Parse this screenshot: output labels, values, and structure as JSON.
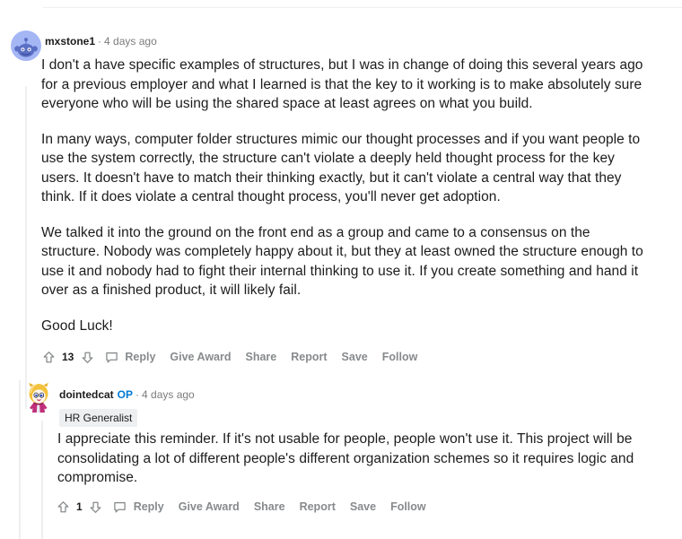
{
  "theme": {
    "text_color": "#1c1c1c",
    "meta_color": "#7c7c7c",
    "action_color": "#878a8c",
    "accent_color": "#0079d3",
    "divider_color": "#edeff1",
    "flair_bg": "#edeff1",
    "avatar_bg": "#a5b6f5"
  },
  "comments": [
    {
      "id": "comment-1",
      "username": "mxstone1",
      "separator": "·",
      "timestamp": "4 days ago",
      "op_badge": null,
      "flair": null,
      "avatar": "reddit-snoo-avatar",
      "paragraphs": [
        "I don't a have specific examples of structures, but I was in change of doing this several years ago for a previous employer and what I learned is that the key to it working is to make absolutely sure everyone who will be using the shared space at least agrees on what you build.",
        "In many ways, computer folder structures mimic our thought processes and if you want people to use the system correctly, the structure can't violate a deeply held thought process for the key users. It doesn't have to match their thinking exactly, but it can't violate a central way that they think. If it does violate a central thought process, you'll never get adoption.",
        "We talked it into the ground on the front end as a group and came to a consensus on the structure. Nobody was completely happy about it, but they at least owned the structure enough to use it and nobody had to fight their internal thinking to use it. If you create something and hand it over as a finished product, it will likely fail.",
        "Good Luck!"
      ],
      "vote_count": "13",
      "actions": [
        "Reply",
        "Give Award",
        "Share",
        "Report",
        "Save",
        "Follow"
      ]
    },
    {
      "id": "comment-2",
      "username": "dointedcat",
      "separator": "·",
      "timestamp": "4 days ago",
      "op_badge": "OP",
      "flair": "HR Generalist",
      "avatar": "custom-character-avatar",
      "paragraphs": [
        "I appreciate this reminder. If it's not usable for people, people won't use it. This project will be consolidating a lot of different people's different organization schemes so it requires logic and compromise."
      ],
      "vote_count": "1",
      "actions": [
        "Reply",
        "Give Award",
        "Share",
        "Report",
        "Save",
        "Follow"
      ]
    }
  ],
  "icons": {
    "upvote": "upvote-arrow-icon",
    "downvote": "downvote-arrow-icon",
    "comment_bubble": "comment-bubble-icon"
  }
}
